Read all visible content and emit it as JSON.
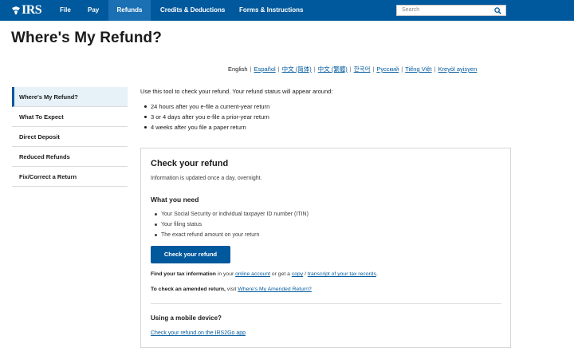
{
  "nav": {
    "logo": "IRS",
    "items": [
      {
        "label": "File"
      },
      {
        "label": "Pay"
      },
      {
        "label": "Refunds"
      },
      {
        "label": "Credits & Deductions"
      },
      {
        "label": "Forms & Instructions"
      }
    ],
    "active_item": "Refunds",
    "search_placeholder": "Search",
    "search_icon": "search-icon"
  },
  "page": {
    "title": "Where's My Refund?"
  },
  "languages": [
    {
      "label": "English",
      "link": false
    },
    {
      "label": "Español",
      "link": true
    },
    {
      "label": "中文 (简体)",
      "link": true
    },
    {
      "label": "中文 (繁體)",
      "link": true
    },
    {
      "label": "한국어",
      "link": true
    },
    {
      "label": "Русский",
      "link": true
    },
    {
      "label": "Tiếng Việt",
      "link": true
    },
    {
      "label": "Kreyòl ayisyen",
      "link": true
    }
  ],
  "sidebar": {
    "items": [
      {
        "label": "Where's My Refund?"
      },
      {
        "label": "What To Expect"
      },
      {
        "label": "Direct Deposit"
      },
      {
        "label": "Reduced Refunds"
      },
      {
        "label": "Fix/Correct a Return"
      }
    ],
    "active_item": "Where's My Refund?"
  },
  "intro": {
    "text": "Use this tool to check your refund. Your refund status will appear around:",
    "bullets": [
      "24 hours after you e-file a current-year return",
      "3 or 4 days after you e-file a prior-year return",
      "4 weeks after you file a paper return"
    ]
  },
  "card": {
    "title": "Check your refund",
    "updated": "Information is updated once a day, overnight.",
    "need_heading": "What you need",
    "need_items": [
      "Your Social Security or individual taxpayer ID number (ITIN)",
      "Your filing status",
      "The exact refund amount on your return"
    ],
    "button_label": "Check your refund",
    "tax_info": {
      "bold": "Find your tax information",
      "pre": " in your ",
      "link1": "online account",
      "mid": " or get a ",
      "link2": "copy",
      "mid2": " / ",
      "link3": "transcript",
      "link4": " of your tax records",
      "end": "."
    },
    "amended": {
      "bold": "To check an amended return,",
      "pre": " visit ",
      "link": "Where's My Amended Return?"
    },
    "mobile_heading": "Using a mobile device?",
    "mobile_link": "Check your refund on the IRS2Go app"
  },
  "colors": {
    "nav_bg": "#00599c",
    "nav_active": "#1b70b3",
    "link": "#00599c",
    "button": "#00599c"
  }
}
